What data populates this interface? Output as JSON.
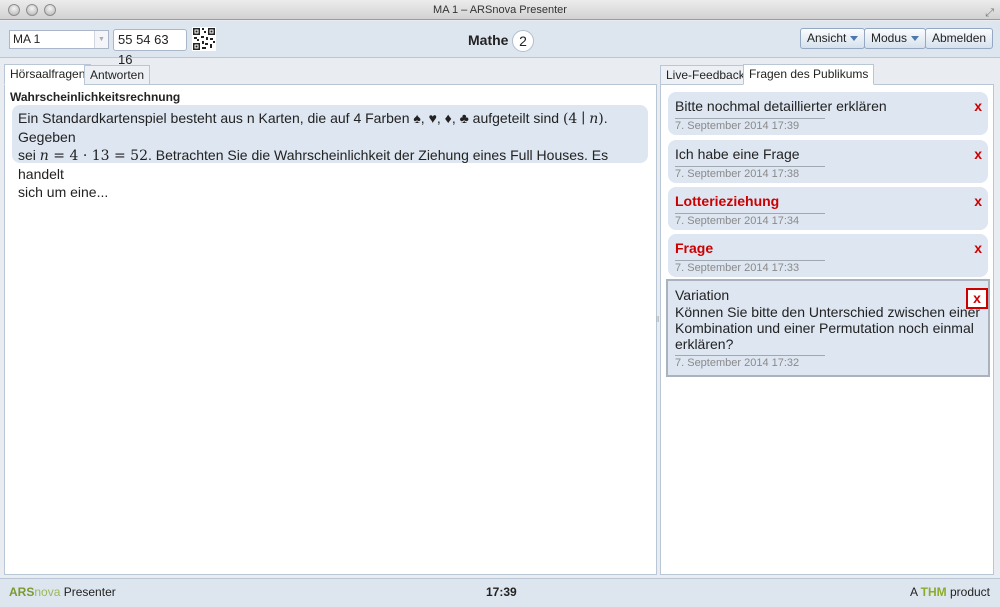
{
  "window": {
    "title": "MA 1 – ARSnova Presenter"
  },
  "toolbar": {
    "session_select": "MA 1",
    "keyword": "55 54 63 16",
    "course_title": "Mathe",
    "online_count": "2",
    "view_button": "Ansicht",
    "mode_button": "Modus",
    "logout_button": "Abmelden"
  },
  "left_tabs": [
    {
      "label": "Hörsaalfragen",
      "active": true
    },
    {
      "label": "Antworten",
      "active": false
    }
  ],
  "right_tabs": [
    {
      "label": "Live-Feedback",
      "active": false
    },
    {
      "label": "Fragen des Publikums",
      "active": true
    }
  ],
  "question": {
    "heading": "Wahrscheinlichkeitsrechnung",
    "text_1": "Ein Standardkartenspiel besteht aus n Karten, die auf 4 Farben ♠, ♥, ♦, ♣ aufgeteilt sind ",
    "math_1a": "(4",
    "math_1b": "∣",
    "math_1c": "n",
    "math_1d": ")",
    "text_2": ". Gegeben",
    "text_3": "sei ",
    "math_2a": "n",
    "math_2b": " = 4 · 13 = 52",
    "text_4": ". Betrachten Sie die Wahrscheinlichkeit der Ziehung eines Full Houses. Es handelt",
    "text_5": "sich um eine..."
  },
  "audience_questions": [
    {
      "subject": "Bitte nochmal detaillierter erklären",
      "date": "7. September 2014 17:39",
      "unread": false,
      "delete": "x"
    },
    {
      "subject": "Ich habe eine Frage",
      "date": "7. September 2014 17:38",
      "unread": false,
      "delete": "x"
    },
    {
      "subject": "Lotterieziehung",
      "date": "7. September 2014 17:34",
      "unread": true,
      "delete": "x"
    },
    {
      "subject": "Frage",
      "date": "7. September 2014 17:33",
      "unread": true,
      "delete": "x"
    },
    {
      "subject": "Variation",
      "text": "Können Sie bitte den Unterschied zwischen einer Kombination und einer Permutation noch einmal erklären?",
      "date": "7. September 2014 17:32",
      "unread": false,
      "delete": "x"
    }
  ],
  "footer": {
    "logo_ars": "ARS",
    "logo_nova": "nova",
    "logo_presenter": " Presenter",
    "time": "17:39",
    "thm_prefix": "A ",
    "thm_brand": "THM",
    "thm_suffix": " product"
  },
  "colors": {
    "accent": "#cc0000",
    "card_bg": "#dde6f1",
    "toolbar_bg": "#dde5ef",
    "brand_green": "#8bab2c"
  }
}
